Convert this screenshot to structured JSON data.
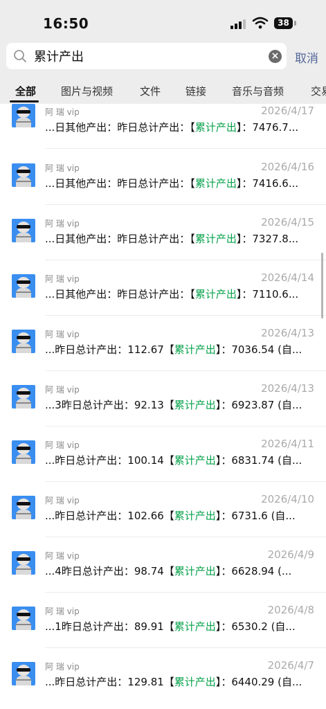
{
  "status": {
    "time": "16:50",
    "battery": "38"
  },
  "search": {
    "query": "累计产出",
    "cancel_label": "取消"
  },
  "tabs": [
    {
      "label": "全部",
      "active": true
    },
    {
      "label": "图片与视频"
    },
    {
      "label": "文件"
    },
    {
      "label": "链接"
    },
    {
      "label": "音乐与音频"
    },
    {
      "label": "交易"
    }
  ],
  "colors": {
    "highlight": "#07a24b",
    "cancel": "#55679a"
  },
  "results": [
    {
      "sender": "阿 瑞 vip",
      "date": "2026/4/17",
      "pre": "...日其他产出：昨日总计产出：【",
      "hl": "累计产出",
      "post": "】：7476.7..."
    },
    {
      "sender": "阿 瑞 vip",
      "date": "2026/4/16",
      "pre": "...日其他产出：昨日总计产出：【",
      "hl": "累计产出",
      "post": "】：7416.6..."
    },
    {
      "sender": "阿 瑞 vip",
      "date": "2026/4/15",
      "pre": "...日其他产出：昨日总计产出：【",
      "hl": "累计产出",
      "post": "】：7327.8..."
    },
    {
      "sender": "阿 瑞 vip",
      "date": "2026/4/14",
      "pre": "...日其他产出：昨日总计产出：【",
      "hl": "累计产出",
      "post": "】：7110.6..."
    },
    {
      "sender": "阿 瑞 vip",
      "date": "2026/4/13",
      "pre": "...昨日总计产出：112.67【",
      "hl": "累计产出",
      "post": "】：7036.54 (自..."
    },
    {
      "sender": "阿 瑞 vip",
      "date": "2026/4/13",
      "pre": "...3昨日总计产出：92.13【",
      "hl": "累计产出",
      "post": "】：6923.87 (自..."
    },
    {
      "sender": "阿 瑞 vip",
      "date": "2026/4/11",
      "pre": "...昨日总计产出：100.14【",
      "hl": "累计产出",
      "post": "】：6831.74 (自..."
    },
    {
      "sender": "阿 瑞 vip",
      "date": "2026/4/10",
      "pre": "...昨日总计产出：102.66【",
      "hl": "累计产出",
      "post": "】：6731.6 (自..."
    },
    {
      "sender": "阿 瑞 vip",
      "date": "2026/4/9",
      "pre": "...4昨日总计产出：98.74【",
      "hl": "累计产出",
      "post": "】：6628.94 (..."
    },
    {
      "sender": "阿 瑞 vip",
      "date": "2026/4/8",
      "pre": "...1昨日总计产出：89.91【",
      "hl": "累计产出",
      "post": "】：6530.2 (自..."
    },
    {
      "sender": "阿 瑞 vip",
      "date": "2026/4/7",
      "pre": "...昨日总计产出：129.81【",
      "hl": "累计产出",
      "post": "】：6440.29 (自..."
    }
  ]
}
